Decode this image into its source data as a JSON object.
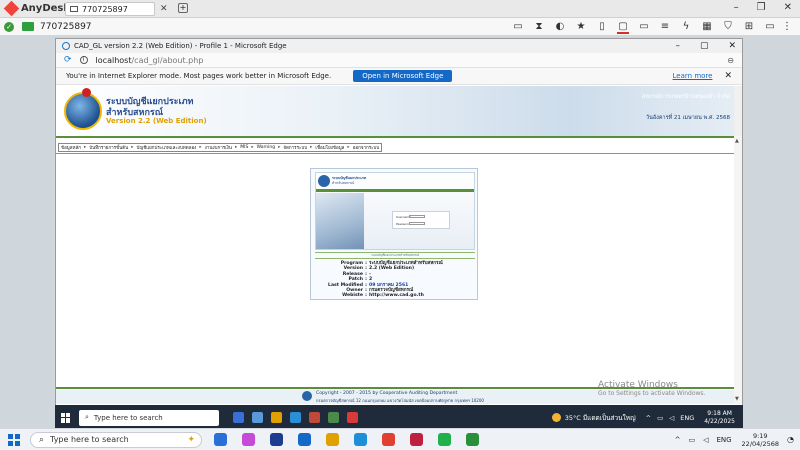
{
  "anydesk": {
    "app_name": "AnyDesk",
    "tab_label": "770725897",
    "address_id": "770725897",
    "tab_close": "✕",
    "tab_add": "+",
    "window_controls": [
      "–",
      "❐",
      "✕"
    ],
    "toolbar_icons": [
      "chat-icon",
      "hourglass-icon",
      "contrast-icon",
      "star-icon",
      "file-transfer-icon",
      "monitor-info-icon",
      "screen-icon",
      "text-icon",
      "power-icon",
      "grid-icon",
      "shield-icon",
      "plus-box-icon",
      "display-icon"
    ],
    "menu": "⋮"
  },
  "edge": {
    "title": "CAD_GL version 2.2 (Web Edition) - Profile 1 - Microsoft Edge",
    "url_host": "localhost",
    "url_path": "/cad_gl/about.php",
    "ie_message": "You're in Internet Explorer mode. Most pages work better in Microsoft Edge.",
    "open_button": "Open in Microsoft Edge",
    "learn_more": "Learn more"
  },
  "site": {
    "name_line1": "ระบบบัญชีแยกประเภท",
    "name_line2": "สำหรับสหกรณ์",
    "version_line": "Version 2.2 (Web Edition)",
    "header_right1": "สหกรณ์การเกษตรบ้านหนองจำ จำกัด",
    "header_right2": "วันอังคารที่ 21 เมษายน พ.ศ. 2568",
    "nav": [
      "ข้อมูลหลัก",
      "บันทึกรายการขั้นต้น",
      "บัญชีแยกประเภทและงบทดลอง",
      "งานงบการเงิน",
      "MIS",
      "Warning",
      "จัดการระบบ",
      "เชื่อมโยงข้อมูล",
      "ออกจากระบบ"
    ],
    "about_mini_title1": "ระบบบัญชีแยกประเภท",
    "about_mini_title2": "สำหรับสหกรณ์",
    "mini_user": "Username",
    "mini_pass": "Password",
    "about_note": "ระบบบัญชีแยกประเภทสำหรับสหกรณ์",
    "about_rows": [
      {
        "key": "Program",
        "value": "ระบบบัญชีแยกประเภทสำหรับสหกรณ์",
        "blue": false
      },
      {
        "key": "Version",
        "value": "2.2 (Web Edition)",
        "blue": false
      },
      {
        "key": "Release",
        "value": "-",
        "blue": false
      },
      {
        "key": "Patch",
        "value": "2",
        "blue": false
      },
      {
        "key": "Last Modified",
        "value": "09 มกราคม 2561",
        "blue": true
      },
      {
        "key": "Owner",
        "value": "กรมตรวจบัญชีสหกรณ์",
        "blue": false
      },
      {
        "key": "Webiste",
        "value": "http://www.cad.go.th",
        "blue": false
      }
    ],
    "footer1": "Copyright - 2007 - 2015 by Cooperative Auditing Department",
    "footer2": "กรมตรวจบัญชีสหกรณ์ 12 ถนนกรุงเกษม แขวงวัดโสมนัส เขตป้อมปราบศัตรูพ่าย กรุงเทพฯ 10200"
  },
  "watermark": {
    "line1": "Activate Windows",
    "line2": "Go to Settings to activate Windows."
  },
  "remote_taskbar": {
    "search_placeholder": "Type here to search",
    "weather": "35°C  มีแดดเป็นส่วนใหญ่",
    "lang": "ENG",
    "time": "9:18 AM",
    "date": "4/22/2025",
    "app_colors": [
      "#3a6fd8",
      "#5a9ad8",
      "#e0a000",
      "#2a8fd8",
      "#c04a3a",
      "#4a8a4a",
      "#d83a3a"
    ]
  },
  "local_taskbar": {
    "search_placeholder": "Type here to search",
    "lang": "ENG",
    "time": "9:19",
    "date": "22/04/2568",
    "app_colors": [
      "#2a6fd8",
      "#c64ad8",
      "#1c3d8f",
      "#1468c8",
      "#e0a000",
      "#1c8fd8",
      "#e04030",
      "#c02040",
      "#22b04a",
      "#2a8f3a"
    ]
  }
}
